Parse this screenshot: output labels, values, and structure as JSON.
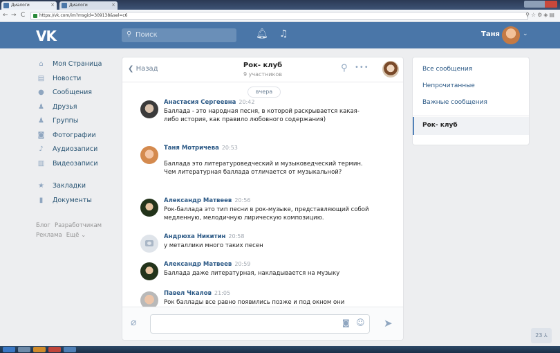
{
  "browser": {
    "tabs": [
      {
        "label": "Диалоги"
      },
      {
        "label": "Диалоги"
      }
    ],
    "url": "https://vk.com/im?msgid=309138&sel=c6"
  },
  "header": {
    "logo": "VK",
    "search_placeholder": "Поиск",
    "user_name": "Таня"
  },
  "sidebar": {
    "items": [
      {
        "label": "Моя Страница",
        "icon": "home-icon"
      },
      {
        "label": "Новости",
        "icon": "news-icon"
      },
      {
        "label": "Сообщения",
        "icon": "messages-icon"
      },
      {
        "label": "Друзья",
        "icon": "friends-icon"
      },
      {
        "label": "Группы",
        "icon": "groups-icon"
      },
      {
        "label": "Фотографии",
        "icon": "photos-icon"
      },
      {
        "label": "Аудиозаписи",
        "icon": "music-icon"
      },
      {
        "label": "Видеозаписи",
        "icon": "video-icon"
      }
    ],
    "items2": [
      {
        "label": "Закладки",
        "icon": "star-icon"
      },
      {
        "label": "Документы",
        "icon": "document-icon"
      }
    ],
    "footer": {
      "blog": "Блог",
      "dev": "Разработчикам",
      "ads": "Реклама",
      "more": "Ещё ⌄"
    }
  },
  "chat": {
    "back_label": "Назад",
    "title": "Рок- клуб",
    "subtitle": "9 участников",
    "date_pill": "вчера",
    "messages": [
      {
        "name": "Анастасия Сергеевна",
        "time": "20:42",
        "text": "Баллада - это народная песня, в которой раскрывается какая-либо история, как правило любовного содержания)"
      },
      {
        "name": "Таня Мотричева",
        "time": "20:53",
        "text": "Баллада это литературоведческий и музыковедческий термин. Чем литературная баллада отличается от музыкальной?"
      },
      {
        "name": "Александр Матвеев",
        "time": "20:56",
        "text": "Рок-баллада это тип песни в рок-музыке, представляющий собой медленную, мелодичную лирическую композицию."
      },
      {
        "name": "Андрюха Никитин",
        "time": "20:58",
        "text": "у металлики много таких песен"
      },
      {
        "name": "Александр Матвеев",
        "time": "20:59",
        "text": "Баллада даже литературная, накладывается на музыку"
      },
      {
        "name": "Павел Чкалов",
        "time": "21:05",
        "text": "Рок баллады все равно появились позже и под окном они"
      }
    ]
  },
  "right_menu": {
    "items": [
      "Все сообщения",
      "Непрочитанные",
      "Важные сообщения"
    ],
    "active": "Рок- клуб"
  },
  "counter": "23 ⅄",
  "colors": {
    "vk_blue": "#4a76a8",
    "link": "#2a5885",
    "bg": "#edeef0"
  }
}
